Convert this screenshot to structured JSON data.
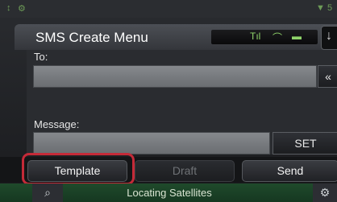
{
  "status_bar": {
    "left_icons": [
      "↕",
      "⚙"
    ],
    "right_icons": [
      "▼",
      "5"
    ]
  },
  "header": {
    "title": "SMS Create Menu",
    "indicator_icons": [
      "Tıl",
      "⌒",
      "▬"
    ],
    "corner_icon": "↓"
  },
  "form": {
    "to_label": "To:",
    "to_value": "",
    "to_button": "«",
    "message_label": "Message:",
    "message_value": "",
    "set_button": "SET"
  },
  "actions": {
    "template": "Template",
    "draft": "Draft",
    "send": "Send"
  },
  "bottom": {
    "left_icon": "⌕",
    "status": "Locating Satellites",
    "right_icon": "⚙"
  },
  "colors": {
    "highlight": "#c42a38",
    "accent_green": "#8fd46a"
  }
}
